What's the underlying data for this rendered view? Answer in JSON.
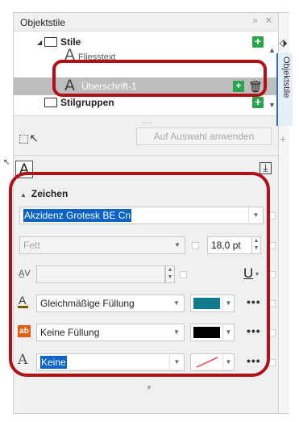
{
  "docker": {
    "title": "Objektstile",
    "vertical_tab": "Objektstile"
  },
  "tree": {
    "styles_label": "Stile",
    "item_fliesstext": "Fliesstext",
    "item_ueberschrift": "Überschrift-1",
    "style_groups_label": "Stilgruppen",
    "ellipsis": "..."
  },
  "apply_button": "Auf Auswahl anwenden",
  "section": {
    "title": "Zeichen",
    "font_name": "Akzidenz Grotesk BE Cn",
    "font_style": "Fett",
    "font_size": "18,0 pt",
    "fill_label": "Gleichmäßige Füllung",
    "fill_color": "#0e7a8c",
    "bg_fill_label": "Keine Füllung",
    "bg_fill_color": "#000000",
    "outline_label": "Keine"
  },
  "colors": {
    "highlight": "#0a64c8",
    "annotation_red": "#b21016",
    "add_green": "#2aa44a"
  }
}
